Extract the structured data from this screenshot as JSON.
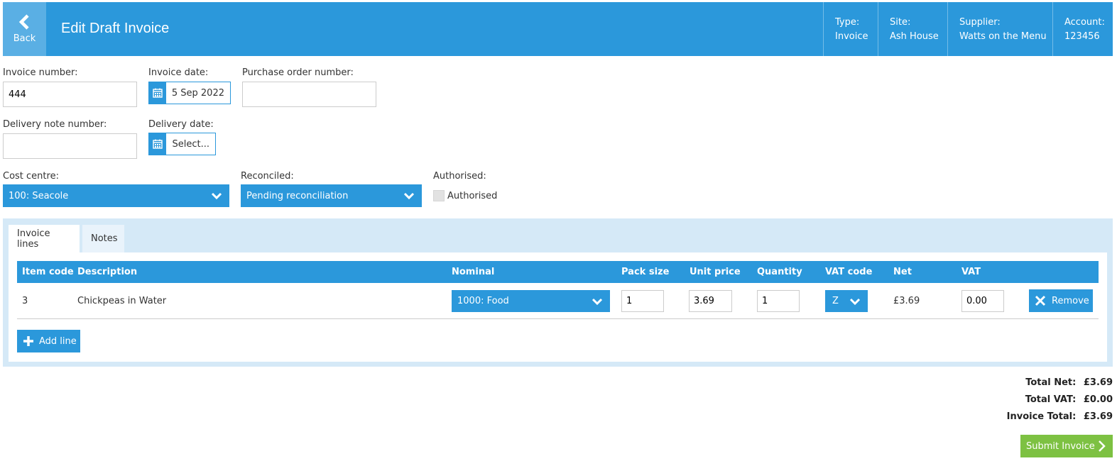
{
  "header": {
    "back_label": "Back",
    "title": "Edit Draft Invoice",
    "meta": [
      {
        "label": "Type:",
        "value": "Invoice"
      },
      {
        "label": "Site:",
        "value": "Ash House"
      },
      {
        "label": "Supplier:",
        "value": "Watts on the Menu"
      },
      {
        "label": "Account:",
        "value": "123456"
      }
    ]
  },
  "form": {
    "invoice_number_label": "Invoice number:",
    "invoice_number_value": "444",
    "invoice_date_label": "Invoice date:",
    "invoice_date_value": "5 Sep 2022",
    "po_number_label": "Purchase order number:",
    "po_number_value": "",
    "delivery_note_label": "Delivery note number:",
    "delivery_note_value": "",
    "delivery_date_label": "Delivery date:",
    "delivery_date_value": "Select...",
    "cost_centre_label": "Cost centre:",
    "cost_centre_value": "100: Seacole",
    "reconciled_label": "Reconciled:",
    "reconciled_value": "Pending reconciliation",
    "authorised_label": "Authorised:",
    "authorised_checkbox_label": "Authorised",
    "authorised_checked": false
  },
  "tabs": [
    {
      "label": "Invoice lines",
      "active": true
    },
    {
      "label": "Notes",
      "active": false
    }
  ],
  "table": {
    "columns": [
      "Item code",
      "Description",
      "Nominal",
      "Pack size",
      "Unit price",
      "Quantity",
      "VAT code",
      "Net",
      "VAT"
    ],
    "rows": [
      {
        "item_code": "3",
        "description": "Chickpeas in Water",
        "nominal": "1000: Food",
        "pack_size": "1",
        "unit_price": "3.69",
        "quantity": "1",
        "vat_code": "Z",
        "net": "£3.69",
        "vat": "0.00",
        "remove_label": "Remove"
      }
    ],
    "add_line_label": "Add line"
  },
  "totals": {
    "total_net_label": "Total Net:",
    "total_net_value": "£3.69",
    "total_vat_label": "Total VAT:",
    "total_vat_value": "£0.00",
    "invoice_total_label": "Invoice Total:",
    "invoice_total_value": "£3.69"
  },
  "submit_label": "Submit Invoice",
  "colors": {
    "primary": "#2b98db",
    "back": "#5aafe4",
    "panel": "#d5e9f7",
    "submit": "#7dc142"
  }
}
